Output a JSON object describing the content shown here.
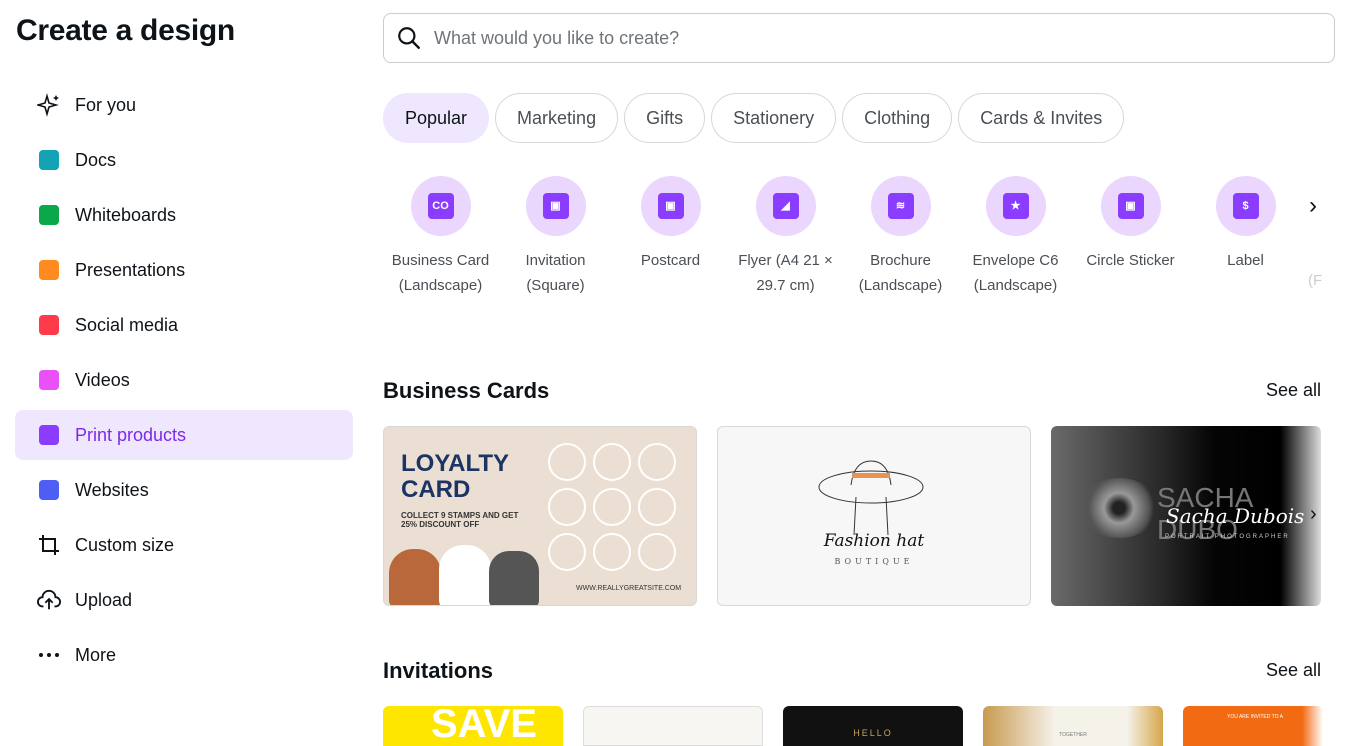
{
  "title": "Create a design",
  "sidebar": {
    "items": [
      {
        "label": "For you",
        "icon": "sparkle-icon",
        "color": "#0e1318"
      },
      {
        "label": "Docs",
        "icon": "docs-icon",
        "color": "#13a3b5"
      },
      {
        "label": "Whiteboards",
        "icon": "whiteboard-icon",
        "color": "#0ba84a"
      },
      {
        "label": "Presentations",
        "icon": "presentation-icon",
        "color": "#ff8a1d"
      },
      {
        "label": "Social media",
        "icon": "heart-icon",
        "color": "#ff3b4b"
      },
      {
        "label": "Videos",
        "icon": "video-icon",
        "color": "#e950f7"
      },
      {
        "label": "Print products",
        "icon": "printer-icon",
        "color": "#8b3dff"
      },
      {
        "label": "Websites",
        "icon": "website-icon",
        "color": "#4e5ef5"
      },
      {
        "label": "Custom size",
        "icon": "crop-icon",
        "color": "#0e1318"
      },
      {
        "label": "Upload",
        "icon": "cloud-upload-icon",
        "color": "#0e1318"
      },
      {
        "label": "More",
        "icon": "more-icon",
        "color": "#0e1318"
      }
    ],
    "active": "Print products"
  },
  "search": {
    "placeholder": "What would you like to create?"
  },
  "tabs": [
    "Popular",
    "Marketing",
    "Gifts",
    "Stationery",
    "Clothing",
    "Cards & Invites"
  ],
  "types": [
    {
      "l1": "Business Card",
      "l2": "(Landscape)",
      "glyph": "CO"
    },
    {
      "l1": "Invitation",
      "l2": "(Square)",
      "glyph": "▣"
    },
    {
      "l1": "Postcard",
      "l2": "",
      "glyph": "▣"
    },
    {
      "l1": "Flyer (A4 21 ×",
      "l2": "29.7 cm)",
      "glyph": "◢"
    },
    {
      "l1": "Brochure",
      "l2": "(Landscape)",
      "glyph": "≋"
    },
    {
      "l1": "Envelope C6",
      "l2": "(Landscape)",
      "glyph": "★"
    },
    {
      "l1": "Circle Sticker",
      "l2": "",
      "glyph": "▣"
    },
    {
      "l1": "Label",
      "l2": "",
      "glyph": "$"
    }
  ],
  "types_partial": "(F",
  "sections": {
    "business": {
      "title": "Business Cards",
      "see_all": "See all",
      "cards": [
        {
          "heading": "LOYALTY CARD",
          "sub": "COLLECT 9 STAMPS AND GET 25% DISCOUNT OFF",
          "url": "WWW.REALLYGREATSITE.COM"
        },
        {
          "heading": "Fashion hat",
          "sub": "BOUTIQUE"
        },
        {
          "heading": "SACHA DUBO",
          "sub": "Sacha Dubois",
          "tag": "PORTRAIT PHOTOGRAPHER"
        }
      ]
    },
    "invitations": {
      "title": "Invitations",
      "see_all": "See all",
      "cards": [
        {
          "text": "SAVE"
        },
        {
          "text": ""
        },
        {
          "text": "HELLO"
        },
        {
          "text": "TOGETHER"
        },
        {
          "text": "YOU ARE INVITED TO A"
        }
      ]
    }
  }
}
